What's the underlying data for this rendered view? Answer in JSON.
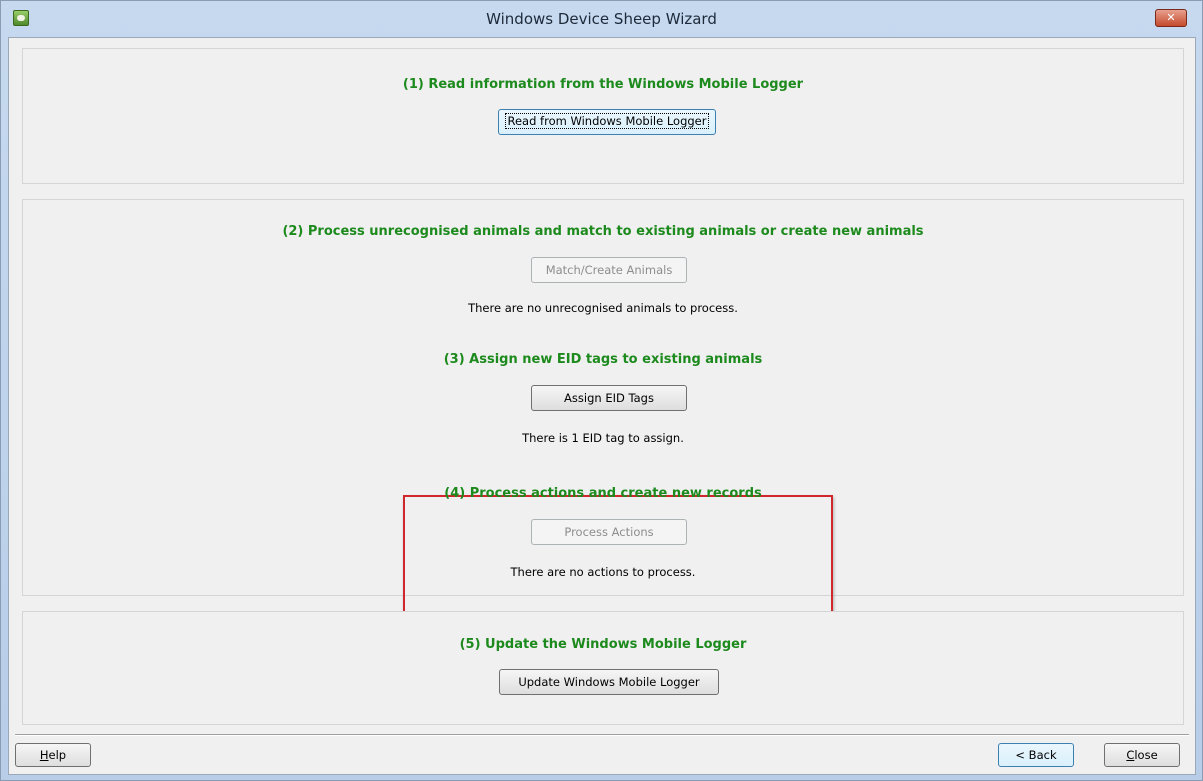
{
  "window": {
    "title": "Windows Device Sheep Wizard",
    "close_glyph": "✕",
    "icon": "sheep-app-icon"
  },
  "step1": {
    "heading": "(1) Read information from the Windows Mobile Logger",
    "button_label": "Read from Windows Mobile Logger"
  },
  "step2": {
    "heading": "(2) Process unrecognised animals and match to existing animals or create new animals",
    "button_label": "Match/Create Animals",
    "status": "There are no unrecognised animals to process."
  },
  "step3": {
    "heading": "(3) Assign new EID tags to existing animals",
    "button_label": "Assign EID Tags",
    "status": "There is 1 EID tag to assign."
  },
  "step4": {
    "heading": "(4) Process actions and create new records",
    "button_label": "Process Actions",
    "status": "There are no actions to process."
  },
  "step5": {
    "heading": "(5) Update the Windows Mobile Logger",
    "button_label": "Update Windows Mobile Logger"
  },
  "footer": {
    "help_first": "H",
    "help_rest": "elp",
    "back_label": "< Back",
    "close_first": "C",
    "close_rest": "lose"
  },
  "colors": {
    "heading_green": "#1d8a1d",
    "highlight_red": "#d0262d"
  }
}
